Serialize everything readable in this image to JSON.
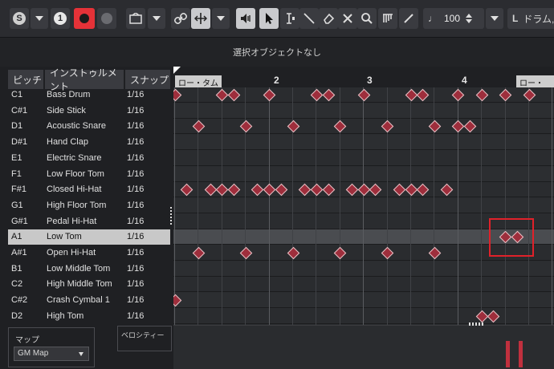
{
  "toolbar": {
    "solo_label": "S",
    "one_label": "1",
    "zoom_value": "100",
    "quantize_L": "L",
    "quantize_text": "ドラム,"
  },
  "info_line": {
    "text": "選択オブジェクトなし"
  },
  "columns": {
    "pitch": "ピッチ",
    "instrument": "インストゥルメント",
    "snap": "スナップ"
  },
  "rows": [
    {
      "pitch": "C1",
      "instrument": "Bass Drum",
      "snap": "1/16"
    },
    {
      "pitch": "C#1",
      "instrument": "Side Stick",
      "snap": "1/16"
    },
    {
      "pitch": "D1",
      "instrument": "Acoustic Snare",
      "snap": "1/16"
    },
    {
      "pitch": "D#1",
      "instrument": "Hand Clap",
      "snap": "1/16"
    },
    {
      "pitch": "E1",
      "instrument": "Electric Snare",
      "snap": "1/16"
    },
    {
      "pitch": "F1",
      "instrument": "Low Floor Tom",
      "snap": "1/16"
    },
    {
      "pitch": "F#1",
      "instrument": "Closed Hi-Hat",
      "snap": "1/16"
    },
    {
      "pitch": "G1",
      "instrument": "High Floor Tom",
      "snap": "1/16"
    },
    {
      "pitch": "G#1",
      "instrument": "Pedal Hi-Hat",
      "snap": "1/16"
    },
    {
      "pitch": "A1",
      "instrument": "Low Tom",
      "snap": "1/16"
    },
    {
      "pitch": "A#1",
      "instrument": "Open Hi-Hat",
      "snap": "1/16"
    },
    {
      "pitch": "B1",
      "instrument": "Low Middle Tom",
      "snap": "1/16"
    },
    {
      "pitch": "C2",
      "instrument": "High Middle Tom",
      "snap": "1/16"
    },
    {
      "pitch": "C#2",
      "instrument": "Crash Cymbal 1",
      "snap": "1/16"
    },
    {
      "pitch": "D2",
      "instrument": "High Tom",
      "snap": "1/16"
    }
  ],
  "map": {
    "label": "マップ",
    "value": "GM Map"
  },
  "velocity_label": "ベロシティー",
  "ruler": {
    "bars": [
      "2",
      "3",
      "4"
    ],
    "locator_left": "ロー・タム",
    "locator_right": "ロー・タム"
  },
  "colors": {
    "note_fill": "#9e2e3c",
    "selection_box": "#e0212a",
    "record_button": "#e53238"
  }
}
